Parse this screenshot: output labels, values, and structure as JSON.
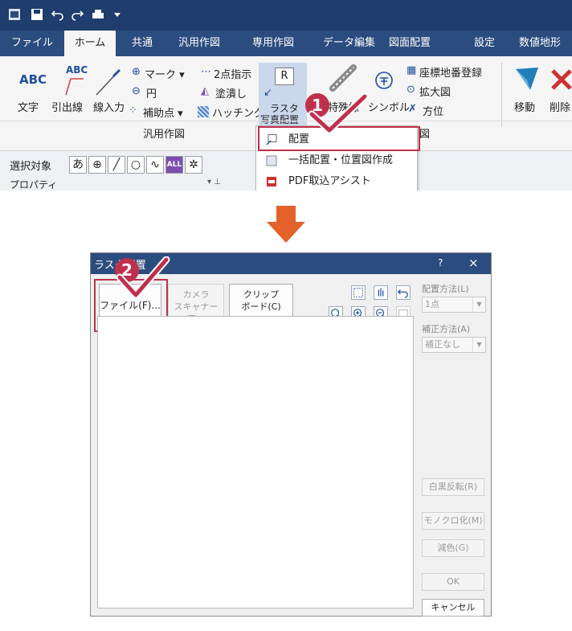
{
  "menu": {
    "tabs": [
      "ファイル",
      "ホーム",
      "共通",
      "汎用作図",
      "専用作図",
      "データ編集",
      "図面配置",
      "設定",
      "数値地形"
    ],
    "active_tab": "ホーム"
  },
  "ribbon": {
    "text_icon_glyph": "ABC",
    "text_label": "文字",
    "leader_icon_glyph": "ABC",
    "leader_label": "引出線",
    "line_input_label": "線入力",
    "mark_label": "マーク",
    "circle_label": "円",
    "aux_point_label": "補助点",
    "two_point_label": "2点指示",
    "fill_label": "塗潰し",
    "hatching_label": "ハッチング",
    "raster_icon_glyph": "R",
    "raster_label_1": "ラスタ",
    "raster_label_2": "写真配置",
    "special_line_label": "特殊線",
    "symbol_label": "シンボル",
    "coord_register_label": "座標地番登録",
    "enlarged_label": "拡大図",
    "direction_label": "方位",
    "move_label": "移動",
    "delete_label": "削除",
    "group_general": "汎用作図",
    "group_partial": "図"
  },
  "selectbar": {
    "label": "選択対象",
    "hiragana_glyph": "あ",
    "all_label": "ALL",
    "property_label": "プロパティ",
    "pin_glyph": "▾ ⊥"
  },
  "dropdown": {
    "items": [
      "配置",
      "一括配置・位置図作成",
      "PDF取込アシスト"
    ],
    "icon_glyph": "R"
  },
  "steps": {
    "step1": "1",
    "step2": "2"
  },
  "dialog": {
    "title": "ラスタ配置",
    "help": "?",
    "close": "×",
    "file_button": "ファイル(F)...",
    "camera_button_1": "カメラ",
    "camera_button_2": "スキャナー(T)...",
    "clipboard_button_1": "クリップ",
    "clipboard_button_2": "ボード(C)",
    "placement_method_label": "配置方法(L)",
    "placement_method_value": "1点",
    "correction_method_label": "補正方法(A)",
    "correction_method_value": "補正なし",
    "invert_button": "白黒反転(R)",
    "mono_button": "モノクロ化(M)",
    "reduce_color_button": "減色(G)",
    "ok_button": "OK",
    "cancel_button": "キャンセル"
  },
  "colors": {
    "accent_red": "#c0304d",
    "titlebar_blue": "#1f3d6d",
    "menubar_blue": "#2b4c7e",
    "arrow_orange": "#e2622a"
  }
}
